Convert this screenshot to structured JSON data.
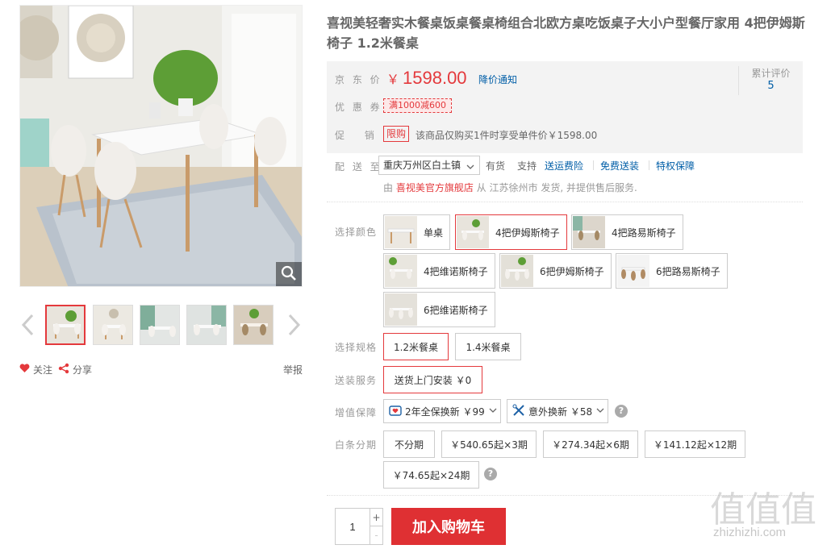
{
  "gallery": {
    "zoom_icon": "search-icon",
    "prev_icon": "chevron-left-icon",
    "next_icon": "chevron-right-icon",
    "thumb_count": 5,
    "active_thumb": 1
  },
  "actions": {
    "follow": "关注",
    "share": "分享",
    "report": "举报"
  },
  "product": {
    "title": "喜视美轻奢实木餐桌饭桌餐桌椅组合北欧方桌吃饭桌子大小户型餐厅家用 4把伊姆斯椅子 1.2米餐桌"
  },
  "summary": {
    "price_label": "京 东 价",
    "currency": "￥",
    "price": "1598.00",
    "price_notify": "降价通知",
    "review_label": "累计评价",
    "review_count": "5",
    "coupon_label": "优 惠 券",
    "coupon": "满1000减600",
    "promo_label": "促　 销",
    "promo_tag": "限购",
    "promo_text": "该商品仅购买1件时享受单件价￥1598.00"
  },
  "delivery": {
    "label": "配 送 至",
    "address": "重庆万州区白土镇",
    "stock": "有货",
    "support": "支持",
    "links": [
      "送运费险",
      "免费送装",
      "特权保障"
    ],
    "from_prefix": "由",
    "shop": "喜视美官方旗舰店",
    "from_suffix": "从 江苏徐州市 发货, 并提供售后服务."
  },
  "options": {
    "color_label": "选择颜色",
    "colors": [
      "单桌",
      "4把伊姆斯椅子",
      "4把路易斯椅子",
      "4把维诺斯椅子",
      "6把伊姆斯椅子",
      "6把路易斯椅子",
      "6把维诺斯椅子"
    ],
    "selected_color": "4把伊姆斯椅子",
    "spec_label": "选择规格",
    "specs": [
      "1.2米餐桌",
      "1.4米餐桌"
    ],
    "service_label": "送装服务",
    "service": "送货上门安装 ￥0",
    "warranty_label": "增值保障",
    "warranty": [
      "2年全保换新 ￥99",
      "意外换新 ￥58"
    ],
    "installment_label": "白条分期",
    "installments": [
      "不分期",
      "￥540.65起×3期",
      "￥274.34起×6期",
      "￥141.12起×12期",
      "￥74.65起×24期"
    ]
  },
  "buy": {
    "quantity": "1",
    "plus": "+",
    "minus": "-",
    "add_to_cart": "加入购物车"
  },
  "watermark": {
    "chars": "值值值",
    "url": "zhizhizhi.com"
  },
  "colors": {
    "accent": "#e4393c",
    "link": "#005ea7",
    "cart": "#df3033"
  }
}
